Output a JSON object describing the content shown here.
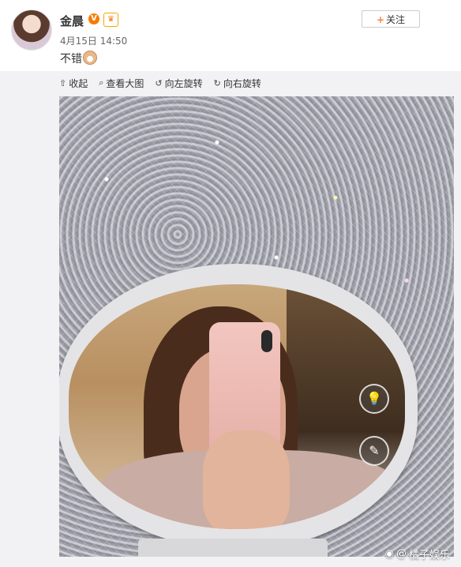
{
  "post": {
    "author": "金晨",
    "vip_badge": "V",
    "member_badge": "♛",
    "timestamp": "4月15日 14:50",
    "follow_label": "关注",
    "follow_plus": "+",
    "text": "不错"
  },
  "toolbar": {
    "collapse": "收起",
    "view_large": "查看大图",
    "rotate_left": "向左旋转",
    "rotate_right": "向右旋转"
  },
  "photo": {
    "watermark": "橘子娱乐",
    "watermark_at": "@"
  },
  "icons": {
    "collapse": "collapse-icon",
    "view_large": "search-icon",
    "rotate_left": "rotate-left-icon",
    "rotate_right": "rotate-right-icon",
    "bulb": "bulb-icon",
    "edit": "pencil-icon",
    "weibo": "weibo-logo-icon"
  }
}
